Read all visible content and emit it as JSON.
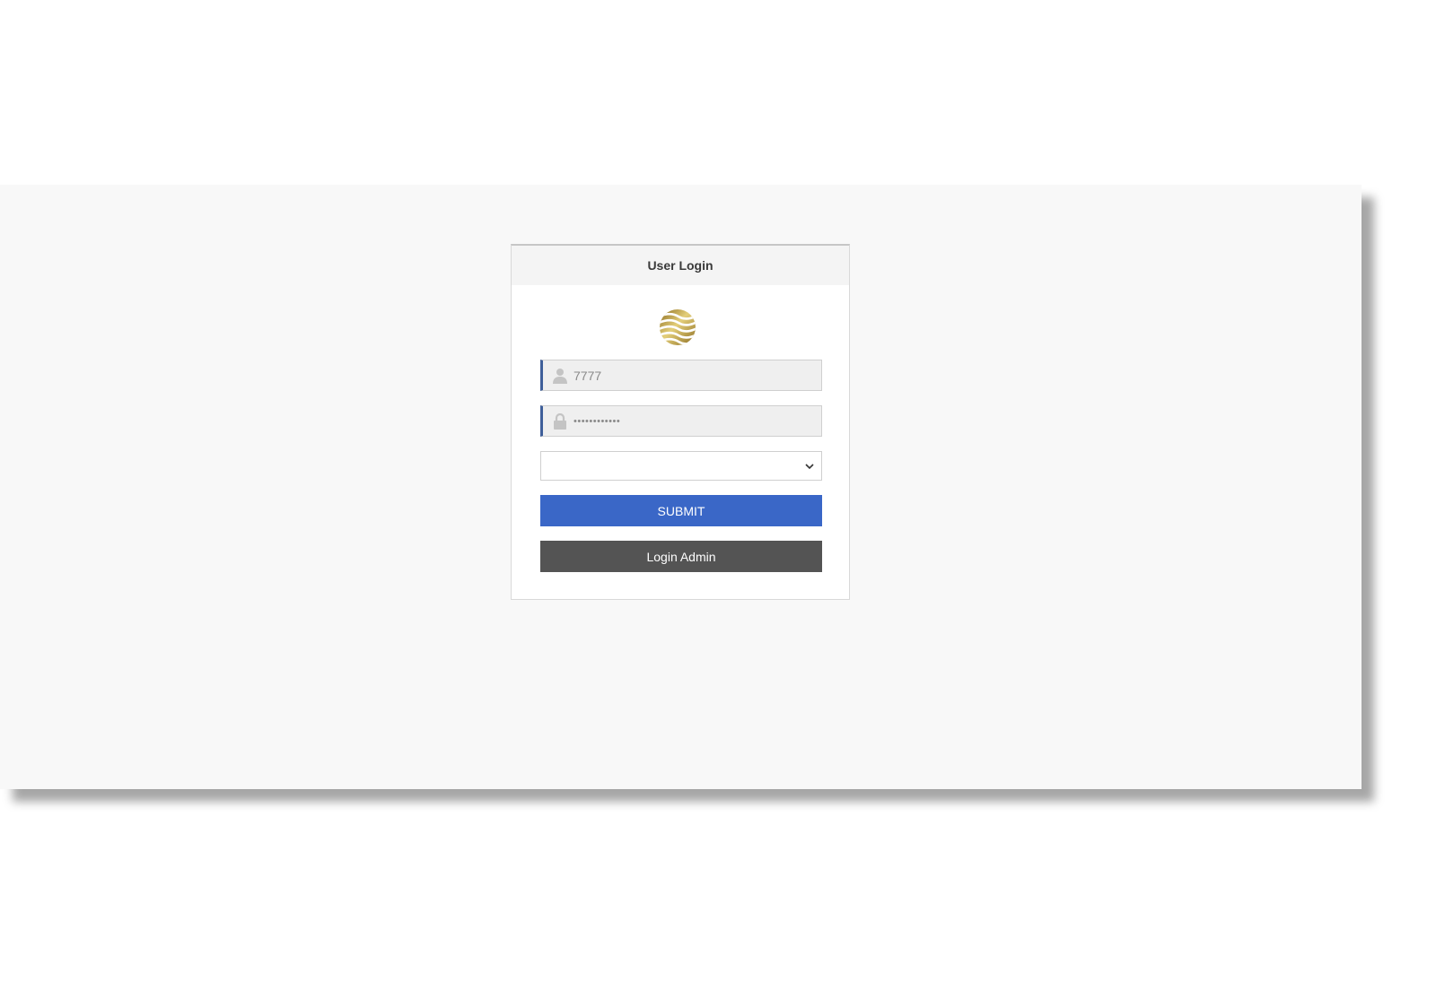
{
  "login": {
    "title": "User Login",
    "username_value": "7777",
    "password_masked": "••••••••••••",
    "submit_label": "SUBMIT",
    "admin_label": "Login Admin"
  },
  "icons": {
    "logo": "gold-striped-sphere-logo",
    "username": "user-icon",
    "password": "lock-icon",
    "select": "chevron-down-icon"
  },
  "colors": {
    "submit": "#3a67c7",
    "admin": "#545454",
    "logo_gold": "#b89a3e",
    "field_accent": "#3f5f9a"
  }
}
